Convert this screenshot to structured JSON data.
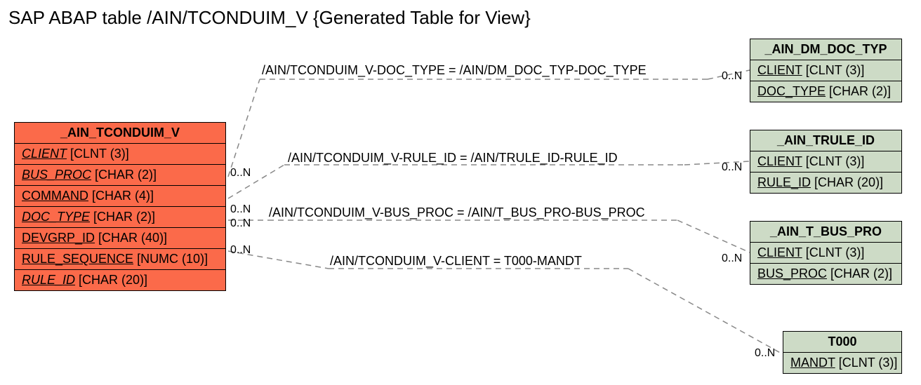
{
  "title": "SAP ABAP table /AIN/TCONDUIM_V {Generated Table for View}",
  "main_entity": {
    "name": "_AIN_TCONDUIM_V",
    "fields": [
      {
        "name": "CLIENT",
        "type": "[CLNT (3)]",
        "fk": true
      },
      {
        "name": "BUS_PROC",
        "type": "[CHAR (2)]",
        "fk": true
      },
      {
        "name": "COMMAND",
        "type": "[CHAR (4)]",
        "fk": false
      },
      {
        "name": "DOC_TYPE",
        "type": "[CHAR (2)]",
        "fk": true
      },
      {
        "name": "DEVGRP_ID",
        "type": "[CHAR (40)]",
        "fk": false
      },
      {
        "name": "RULE_SEQUENCE",
        "type": "[NUMC (10)]",
        "fk": false
      },
      {
        "name": "RULE_ID",
        "type": "[CHAR (20)]",
        "fk": true
      }
    ]
  },
  "related": {
    "dm_doc_typ": {
      "name": "_AIN_DM_DOC_TYP",
      "fields": [
        {
          "name": "CLIENT",
          "type": "[CLNT (3)]"
        },
        {
          "name": "DOC_TYPE",
          "type": "[CHAR (2)]"
        }
      ]
    },
    "trule_id": {
      "name": "_AIN_TRULE_ID",
      "fields": [
        {
          "name": "CLIENT",
          "type": "[CLNT (3)]"
        },
        {
          "name": "RULE_ID",
          "type": "[CHAR (20)]"
        }
      ]
    },
    "t_bus_pro": {
      "name": "_AIN_T_BUS_PRO",
      "fields": [
        {
          "name": "CLIENT",
          "type": "[CLNT (3)]"
        },
        {
          "name": "BUS_PROC",
          "type": "[CHAR (2)]"
        }
      ]
    },
    "t000": {
      "name": "T000",
      "fields": [
        {
          "name": "MANDT",
          "type": "[CLNT (3)]"
        }
      ]
    }
  },
  "relations": {
    "r1": {
      "label": "/AIN/TCONDUIM_V-DOC_TYPE = /AIN/DM_DOC_TYP-DOC_TYPE",
      "card_left": "0..N",
      "card_right": "0..N"
    },
    "r2": {
      "label": "/AIN/TCONDUIM_V-RULE_ID = /AIN/TRULE_ID-RULE_ID",
      "card_left": "0..N",
      "card_right": "0..N"
    },
    "r3": {
      "label": "/AIN/TCONDUIM_V-BUS_PROC = /AIN/T_BUS_PRO-BUS_PROC",
      "card_left": "0..N",
      "card_right": "0..N"
    },
    "r4": {
      "label": "/AIN/TCONDUIM_V-CLIENT = T000-MANDT",
      "card_left": "0..N",
      "card_right": "0..N"
    }
  }
}
